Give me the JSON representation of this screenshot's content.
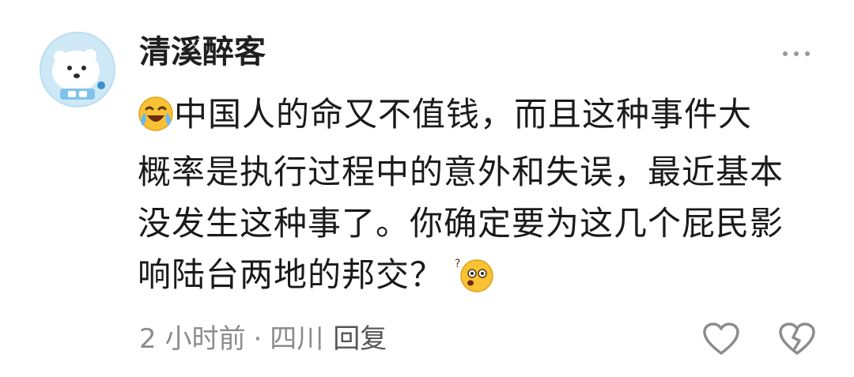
{
  "comment": {
    "username": "清溪醉客",
    "avatar_icon": "polar-bear-astronaut-avatar",
    "text_line1": "中国人的命又不值钱，而且这种事件大",
    "text_line2": "概率是执行过程中的意外和失误，最近基本",
    "text_line3": "没发生这种事了。你确定要为这几个屁民影",
    "text_line4": "响陆台两地的邦交？",
    "emoji_start": "crying-laughing-emoji",
    "emoji_end": "confused-whistling-emoji",
    "time": "2 小时前",
    "location": "四川",
    "reply_label": "回复",
    "more_icon": "more-dots-icon",
    "like_icon": "heart-icon",
    "dislike_icon": "broken-heart-icon"
  }
}
